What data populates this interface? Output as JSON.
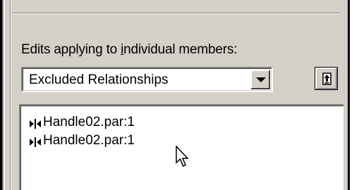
{
  "section": {
    "label_prefix": "Edits applying to ",
    "label_mnemonic": "i",
    "label_suffix": "ndividual members:"
  },
  "combo": {
    "selected": "Excluded Relationships",
    "arrow_icon": "chevron-down-icon"
  },
  "tool_button": {
    "icon": "upload-arrow-icon"
  },
  "list": {
    "items": [
      {
        "label": "Handle02.par:1",
        "icon": "relationship-icon"
      },
      {
        "label": "Handle02.par:1",
        "icon": "relationship-icon"
      }
    ]
  },
  "cursor": {
    "icon": "mouse-pointer-icon"
  }
}
